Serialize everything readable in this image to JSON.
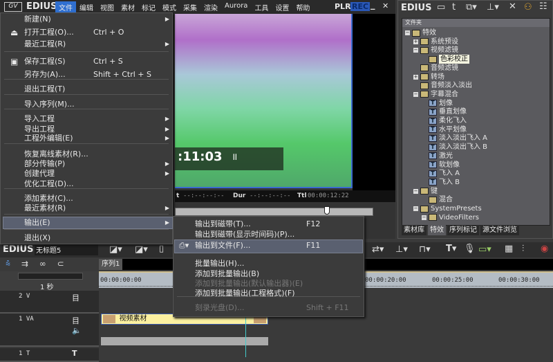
{
  "main_window": {
    "app_name": "EDIUS",
    "menubar": [
      "文件",
      "编辑",
      "视图",
      "素材",
      "标记",
      "模式",
      "采集",
      "渲染",
      "Aurora",
      "工具",
      "设置",
      "帮助"
    ],
    "plr": "PLR",
    "rec": "REC",
    "minimize": "_",
    "close": "✕"
  },
  "preview": {
    "timecode": ":11:03",
    "pause": "॥",
    "in_label": "t",
    "in_value": "--:--:--:--",
    "dur_label": "Dur",
    "dur_value": "--:--:--:--",
    "ttl_label": "Ttl",
    "ttl_value": "00:00:12:22",
    "scrub_position": 0.77
  },
  "file_menu": [
    {
      "label": "新建(N)",
      "submenu": true
    },
    {
      "label": "打开工程(O)...",
      "shortcut": "Ctrl + O",
      "icon": "open-icon"
    },
    {
      "label": "最近工程(R)",
      "submenu": true
    },
    {
      "label": "保存工程(S)",
      "shortcut": "Ctrl + S",
      "icon": "save-icon"
    },
    {
      "label": "另存为(A)...",
      "shortcut": "Shift + Ctrl + S"
    },
    {
      "label": "退出工程(T)"
    },
    {
      "label": "导入序列(M)..."
    },
    {
      "label": "导入工程",
      "submenu": true
    },
    {
      "label": "导出工程",
      "submenu": true
    },
    {
      "label": "工程外编辑(E)",
      "submenu": true
    },
    {
      "label": "恢复离线素材(R)..."
    },
    {
      "label": "部分传输(P)",
      "submenu": true
    },
    {
      "label": "创建代理",
      "submenu": true
    },
    {
      "label": "优化工程(D)..."
    },
    {
      "label": "添加素材(C)..."
    },
    {
      "label": "最近素材(R)",
      "submenu": true
    },
    {
      "label": "输出(E)",
      "submenu": true,
      "highlighted": true
    },
    {
      "label": "退出(X)"
    }
  ],
  "output_submenu": [
    {
      "label": "输出到磁带(T)...",
      "shortcut": "F12"
    },
    {
      "label": "输出到磁带(显示时间码)(P)..."
    },
    {
      "label": "输出到文件(F)...",
      "shortcut": "F11",
      "highlighted": true
    },
    {
      "label": "批量输出(H)..."
    },
    {
      "label": "添加到批量输出(B)"
    },
    {
      "label": "添加到批量输出(默认输出器)(E)",
      "disabled": true
    },
    {
      "label": "添加到批量输出(工程格式)(F)"
    },
    {
      "label": "刻录光盘(D)...",
      "shortcut": "Shift + F11",
      "disabled": true
    }
  ],
  "effects_panel": {
    "app_name": "EDIUS",
    "header": "文件夹",
    "tree": [
      {
        "label": "特效",
        "level": 0,
        "exp": "-",
        "type": "folder"
      },
      {
        "label": "系统预设",
        "level": 1,
        "exp": "+",
        "type": "folder"
      },
      {
        "label": "视频滤镜",
        "level": 1,
        "exp": "-",
        "type": "folder"
      },
      {
        "label": "色彩校正",
        "level": 2,
        "type": "folder",
        "selected": true
      },
      {
        "label": "音频滤镜",
        "level": 1,
        "type": "folder"
      },
      {
        "label": "转场",
        "level": 1,
        "exp": "+",
        "type": "folder"
      },
      {
        "label": "音频淡入淡出",
        "level": 1,
        "type": "folder"
      },
      {
        "label": "字幕混合",
        "level": 1,
        "exp": "-",
        "type": "folder"
      },
      {
        "label": "划像",
        "level": 2,
        "type": "t"
      },
      {
        "label": "垂直划像",
        "level": 2,
        "type": "t"
      },
      {
        "label": "柔化飞入",
        "level": 2,
        "type": "t"
      },
      {
        "label": "水平划像",
        "level": 2,
        "type": "t"
      },
      {
        "label": "淡入淡出飞入 A",
        "level": 2,
        "type": "t"
      },
      {
        "label": "淡入淡出飞入 B",
        "level": 2,
        "type": "t"
      },
      {
        "label": "激光",
        "level": 2,
        "type": "t"
      },
      {
        "label": "软划像",
        "level": 2,
        "type": "t"
      },
      {
        "label": "飞入 A",
        "level": 2,
        "type": "t"
      },
      {
        "label": "飞入 B",
        "level": 2,
        "type": "t"
      },
      {
        "label": "键",
        "level": 1,
        "exp": "-",
        "type": "folder"
      },
      {
        "label": "混合",
        "level": 2,
        "type": "folder"
      },
      {
        "label": "SystemPresets",
        "level": 1,
        "exp": "-",
        "type": "folder"
      },
      {
        "label": "VideoFilters",
        "level": 2,
        "exp": "-",
        "type": "folder"
      }
    ],
    "tabs": [
      "素材库",
      "特效",
      "序列标记",
      "源文件浏览"
    ],
    "active_tab": 1
  },
  "timeline": {
    "app_name": "EDIUS",
    "project_name": "无标题5",
    "sequence_tab": "序列1",
    "scale": "1 秒",
    "ruler": [
      "00:00:00:00",
      "00:00:20:00",
      "00:00:25:00",
      "00:00:30:00"
    ],
    "tracks": [
      {
        "name": "2 V"
      },
      {
        "name": "1 VA"
      },
      {
        "name": "1 T"
      }
    ],
    "clip_label": "视频素材"
  }
}
